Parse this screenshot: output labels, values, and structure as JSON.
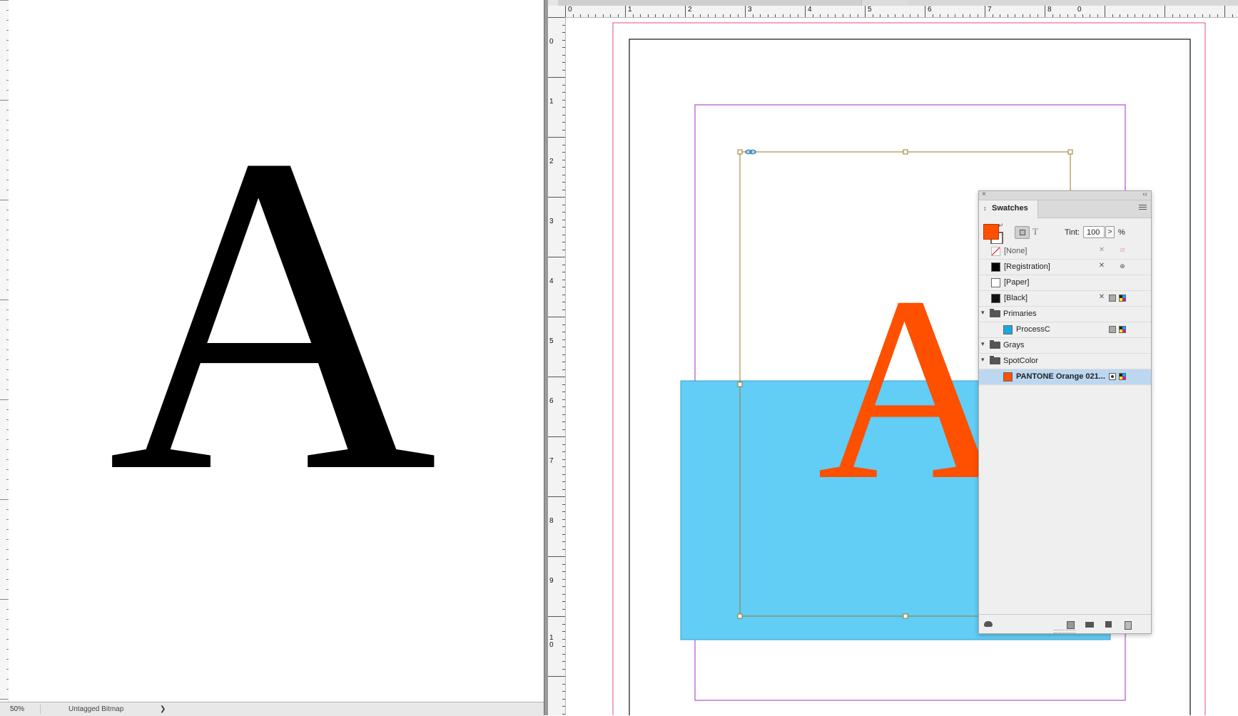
{
  "left_window": {
    "glyph": "A",
    "status": {
      "zoom": "50%",
      "profile": "Untagged Bitmap",
      "arrow": "❯"
    }
  },
  "right_window": {
    "ruler_top": [
      "0",
      "1",
      "2",
      "3",
      "4",
      "5",
      "6",
      "7",
      "8",
      "0"
    ],
    "ruler_left": [
      "0",
      "1",
      "2",
      "3",
      "4",
      "5",
      "6",
      "7",
      "8",
      "9",
      "1",
      "0"
    ],
    "document": {
      "glyph": "A",
      "glyph_color": "#ff5000",
      "rect_color": "#62cdf5"
    }
  },
  "swatches_panel": {
    "title": "Swatches",
    "close_glyph": "×",
    "collapse_glyph": "‹‹",
    "sort_glyph": "↕",
    "fill_color": "#ff5000",
    "text_toggle_glyph": "T",
    "swap_glyph": "↵",
    "tint_label": "Tint:",
    "tint_value": "100",
    "tint_stepper": ">",
    "tint_unit": "%",
    "swatches": [
      {
        "name": "[None]",
        "chip": "none",
        "icons": [
          "locked",
          "none"
        ]
      },
      {
        "name": "[Registration]",
        "chip": "#000000",
        "icons": [
          "locked",
          "registration"
        ]
      },
      {
        "name": "[Paper]",
        "chip": "#ffffff",
        "icons": []
      },
      {
        "name": "[Black]",
        "chip": "#111111",
        "icons": [
          "locked",
          "process",
          "cmyk"
        ]
      }
    ],
    "groups": [
      {
        "name": "Primaries",
        "items": [
          {
            "name": "ProcessC",
            "chip": "#1aa7e0",
            "icons": [
              "process",
              "cmyk"
            ]
          }
        ]
      },
      {
        "name": "Grays",
        "items": []
      },
      {
        "name": "SpotColor",
        "items": [
          {
            "name": "PANTONE Orange 021...",
            "chip": "#ff5000",
            "selected": true,
            "icons": [
              "spot",
              "cmyk"
            ]
          }
        ]
      }
    ],
    "footer_icons": [
      "cc-libraries-icon",
      "new-color-group-icon",
      "folder-icon",
      "new-swatch-icon",
      "trash-icon"
    ]
  }
}
